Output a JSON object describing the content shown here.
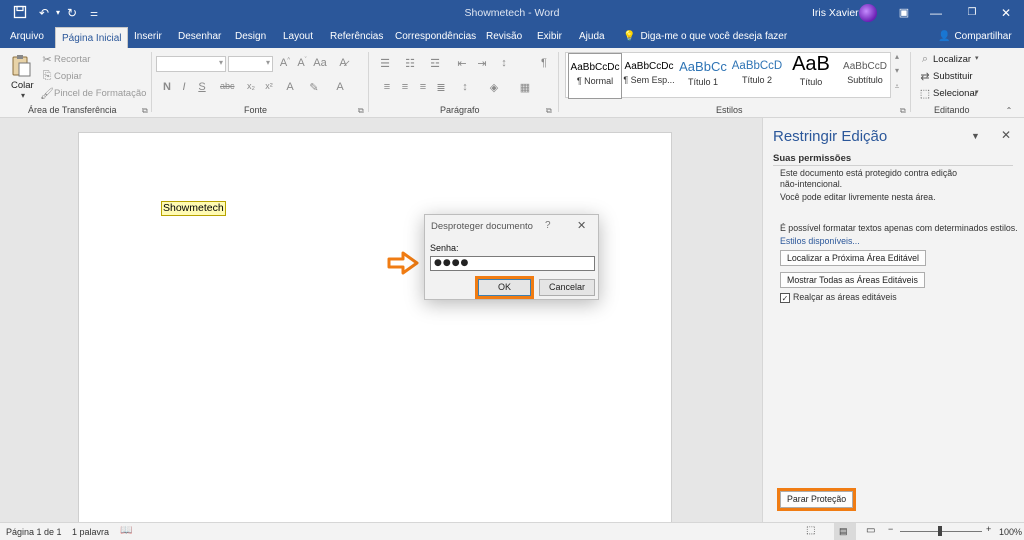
{
  "title_bar": {
    "title": "Showmetech - Word",
    "user": "Iris Xavier"
  },
  "tabs": [
    {
      "label": "Arquivo"
    },
    {
      "label": "Página Inicial",
      "active": true
    },
    {
      "label": "Inserir"
    },
    {
      "label": "Desenhar"
    },
    {
      "label": "Design"
    },
    {
      "label": "Layout"
    },
    {
      "label": "Referências"
    },
    {
      "label": "Correspondências"
    },
    {
      "label": "Revisão"
    },
    {
      "label": "Exibir"
    },
    {
      "label": "Ajuda"
    }
  ],
  "tell_me": "Diga-me o que você deseja fazer",
  "share": "Compartilhar",
  "ribbon": {
    "clipboard": {
      "paste": "Colar",
      "cut": "Recortar",
      "copy": "Copiar",
      "format_painter": "Pincel de Formatação",
      "group": "Área de Transferência"
    },
    "font_group": "Fonte",
    "paragraph_group": "Parágrafo",
    "styles_group": "Estilos",
    "editing": {
      "find": "Localizar",
      "replace": "Substituir",
      "select": "Selecionar",
      "group": "Editando"
    },
    "styles": [
      {
        "preview": "AaBbCcDc",
        "name": "¶ Normal"
      },
      {
        "preview": "AaBbCcDc",
        "name": "¶ Sem Esp..."
      },
      {
        "preview": "AaBbCc",
        "name": "Título 1"
      },
      {
        "preview": "AaBbCcD",
        "name": "Título 2"
      },
      {
        "preview": "AaB",
        "name": "Título"
      },
      {
        "preview": "AaBbCcD",
        "name": "Subtítulo"
      }
    ]
  },
  "document": {
    "text": "Showmetech"
  },
  "dialog": {
    "title": "Desproteger documento",
    "help": "?",
    "password_label": "Senha:",
    "password_value": "●●●●",
    "ok": "OK",
    "cancel": "Cancelar"
  },
  "pane": {
    "title": "Restringir Edição",
    "permissions_heading": "Suas permissões",
    "protected_line1": "Este documento está protegido contra edição",
    "protected_line2": "não-intencional.",
    "free_edit": "Você pode editar livremente nesta área.",
    "format_note": "É possível formatar textos apenas com determinados estilos.",
    "styles_link": "Estilos disponíveis...",
    "find_next_region": "Localizar a Próxima Área Editável",
    "show_all_regions": "Mostrar Todas as Áreas Editáveis",
    "highlight_regions": "Realçar as áreas editáveis",
    "highlight_checked": true,
    "stop_protection": "Parar Proteção"
  },
  "status": {
    "page": "Página 1 de 1",
    "words": "1 palavra",
    "zoom": "100%"
  },
  "colors": {
    "word_blue": "#2b579a",
    "highlight_orange": "#f07c13"
  }
}
